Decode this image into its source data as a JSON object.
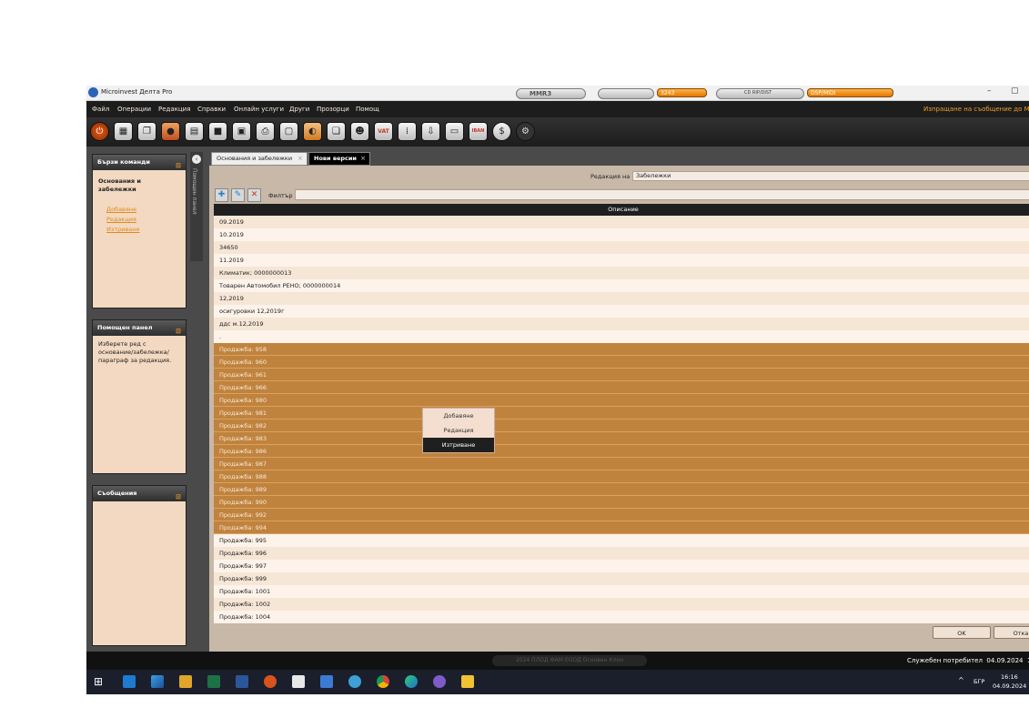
{
  "window": {
    "title": "Microinvest Делта Pro",
    "minimize_glyph": "–",
    "maximize_glyph": "▢"
  },
  "player": {
    "brand": "MMR3",
    "counter": "3243",
    "bar_text": "CD RIP/DIST",
    "label": "DSP/MIDI"
  },
  "menu": {
    "items": [
      "Файл",
      "Операции",
      "Редакция",
      "Справки",
      "Онлайн услуги",
      "Други",
      "Прозорци",
      "Помощ"
    ],
    "send_message": "Изпращане на съобщение до Mi"
  },
  "toolbar": {
    "icons": [
      "power-icon",
      "calculator-icon",
      "documents-icon",
      "cart-icon",
      "cash-register-icon",
      "ledger-icon",
      "report-icon",
      "printer-icon",
      "document-icon",
      "payment-icon",
      "folder-icon",
      "user-icon",
      "vat-icon",
      "stats-icon",
      "export-icon",
      "import-icon",
      "iban-icon",
      "currency-icon",
      "settings-icon"
    ],
    "vat_label": "VAT",
    "iban_label": "IBAN"
  },
  "quick_commands": {
    "title": "Бързи команди",
    "heading": "Основания и забележки",
    "links": [
      "Добавяне",
      "Редакция",
      "Изтриване"
    ]
  },
  "help_panel": {
    "title": "Помощен панел",
    "text": "Изберете ред с основание/забележка/ параграф за редакция."
  },
  "messages_panel": {
    "title": "Съобщения"
  },
  "side_tab": {
    "label": "Помощен панел"
  },
  "tabs": [
    {
      "label": "Основания и забележки",
      "active": false
    },
    {
      "label": "Нови версии",
      "active": true
    }
  ],
  "editor": {
    "label": "Редакция на",
    "value": "Забележки"
  },
  "filter": {
    "label": "Филтър",
    "value": ""
  },
  "grid": {
    "header": "Описание",
    "rows": [
      {
        "text": "09.2019",
        "selected": false
      },
      {
        "text": "10.2019",
        "selected": false
      },
      {
        "text": "34650",
        "selected": false
      },
      {
        "text": "11.2019",
        "selected": false
      },
      {
        "text": "Климатик; 0000000013",
        "selected": false
      },
      {
        "text": "Товарен Автомобил РЕНО; 0000000014",
        "selected": false
      },
      {
        "text": "12,2019",
        "selected": false
      },
      {
        "text": "осигуровки 12,2019г",
        "selected": false
      },
      {
        "text": "ддс м.12,2019",
        "selected": false
      },
      {
        "text": ".",
        "selected": false
      },
      {
        "text": "Продажба: 958",
        "selected": true
      },
      {
        "text": "Продажба: 960",
        "selected": true
      },
      {
        "text": "Продажба: 961",
        "selected": true
      },
      {
        "text": "Продажба: 966",
        "selected": true
      },
      {
        "text": "Продажба: 980",
        "selected": true
      },
      {
        "text": "Продажба: 981",
        "selected": true
      },
      {
        "text": "Продажба: 982",
        "selected": true
      },
      {
        "text": "Продажба: 983",
        "selected": true
      },
      {
        "text": "Продажба: 986",
        "selected": true
      },
      {
        "text": "Продажба: 987",
        "selected": true
      },
      {
        "text": "Продажба: 988",
        "selected": true
      },
      {
        "text": "Продажба: 989",
        "selected": true
      },
      {
        "text": "Продажба: 990",
        "selected": true
      },
      {
        "text": "Продажба: 992",
        "selected": true
      },
      {
        "text": "Продажба: 994",
        "selected": true
      },
      {
        "text": "Продажба: 995",
        "selected": false
      },
      {
        "text": "Продажба: 996",
        "selected": false
      },
      {
        "text": "Продажба: 997",
        "selected": false
      },
      {
        "text": "Продажба: 999",
        "selected": false
      },
      {
        "text": "Продажба: 1001",
        "selected": false
      },
      {
        "text": "Продажба: 1002",
        "selected": false
      },
      {
        "text": "Продажба: 1004",
        "selected": false
      }
    ]
  },
  "context_menu": {
    "items": [
      "Добавяне",
      "Редакция",
      "Изтриване"
    ],
    "active_index": 2
  },
  "buttons": {
    "ok": "OK",
    "cancel": "Отка"
  },
  "status": {
    "center": "2024 ПЛОД ФАМ ЕООД Основен Клон",
    "user": "Служебен потребител",
    "date": "04.09.2024",
    "tail": "1"
  },
  "taskbar": {
    "icons": [
      "windows-start-icon",
      "task-view-icon",
      "chart-app-icon",
      "app-icon",
      "excel-icon",
      "word-icon",
      "security-icon",
      "notepad-icon",
      "delta-icon",
      "network-icon",
      "chrome-icon",
      "edge-icon",
      "viber-icon",
      "explorer-icon"
    ],
    "language": "БГР",
    "time": "16:16",
    "date": "04.09.2024",
    "tray_arrow": "^"
  },
  "colors": {
    "accent": "#f29b2b",
    "selected_row": "#c0833e",
    "panel": "#f3d9c2"
  }
}
